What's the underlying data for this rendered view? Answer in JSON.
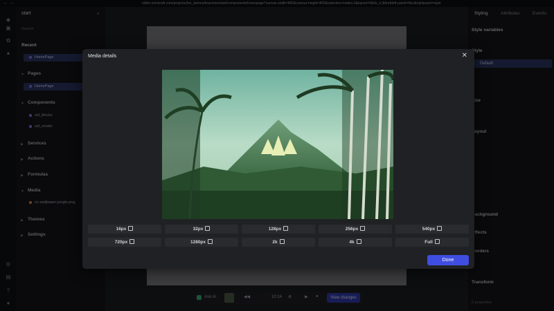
{
  "browser": {
    "url": "editor.nordcraft.com/projects/fun_demos/branches/start/components/homepage?canvas-width=800&canvas-height=800&selection=nodes.0&layout=0&ds_rl.jhbm&left-panel=files&rightpanel=style"
  },
  "sidebar": {
    "project": "start",
    "search_placeholder": "Search",
    "sections": {
      "recent": "Recent",
      "pages": "Pages",
      "components": "Components",
      "services": "Services",
      "actions": "Actions",
      "formulas": "Formulas",
      "media": "Media",
      "themes": "Themes",
      "settings": "Settings"
    },
    "recent_items": [
      "HomePage"
    ],
    "page_items": [
      "HomePage"
    ],
    "component_items": [
      "ssf_blocks",
      "ssf_render"
    ],
    "media_items": [
      "nc-wallpaper-jungle.png"
    ]
  },
  "right_panel": {
    "tabs": [
      "Styling",
      "Attributes",
      "Events"
    ],
    "sections": [
      "Style variables",
      "Style",
      "Size",
      "Layout",
      "Background",
      "Effects",
      "Borders",
      "Transform"
    ],
    "style_default": "Default",
    "footer": "0 properties"
  },
  "toolbar": {
    "ask_ai": "Ask AI",
    "time": "10:24",
    "view_changes": "View changes"
  },
  "modal": {
    "title": "Media details",
    "sizes": [
      "16px",
      "32px",
      "128px",
      "256px",
      "540px",
      "720px",
      "1280px",
      "2k",
      "4k",
      "Full"
    ],
    "done": "Done"
  },
  "colors": {
    "accent": "#3f4ee0",
    "selected_item": "#2a3560"
  }
}
